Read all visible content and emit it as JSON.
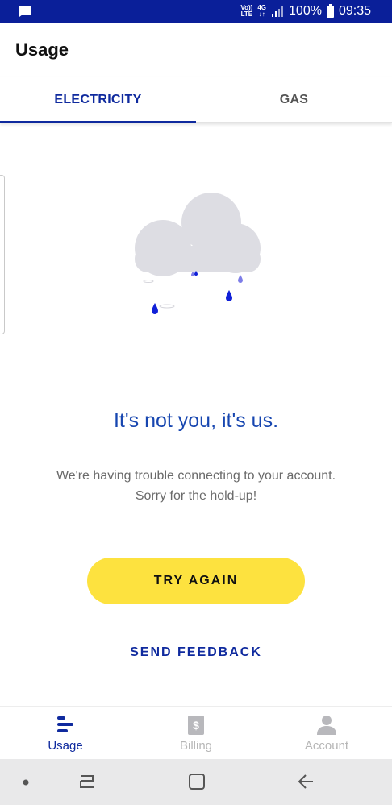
{
  "status_bar": {
    "volte_label_1": "Vo))",
    "volte_label_2": "LTE",
    "network_label_1": "4G",
    "network_label_2": "↓↑",
    "battery_text": "100%",
    "time": "09:35",
    "icons": [
      "message-icon",
      "signal-icon",
      "battery-icon"
    ]
  },
  "app_bar": {
    "title": "Usage"
  },
  "tabs": [
    {
      "label": "ELECTRICITY",
      "selected": true
    },
    {
      "label": "GAS",
      "selected": false
    }
  ],
  "error": {
    "title": "It's not you, it's us.",
    "line1": "We're having trouble connecting to your account.",
    "line2": "Sorry for the hold-up!"
  },
  "actions": {
    "try_again": "TRY AGAIN",
    "send_feedback": "SEND FEEDBACK"
  },
  "bottom_nav": [
    {
      "label": "Usage",
      "icon": "usage-bars-icon",
      "active": true
    },
    {
      "label": "Billing",
      "icon": "billing-dollar-icon",
      "active": false
    },
    {
      "label": "Account",
      "icon": "account-person-icon",
      "active": false
    }
  ],
  "colors": {
    "status_bar": "#0a1f99",
    "primary": "#0f2a9e",
    "accent_button": "#fde23f",
    "error_title": "#1746b0",
    "cloud": "#dddde3"
  }
}
